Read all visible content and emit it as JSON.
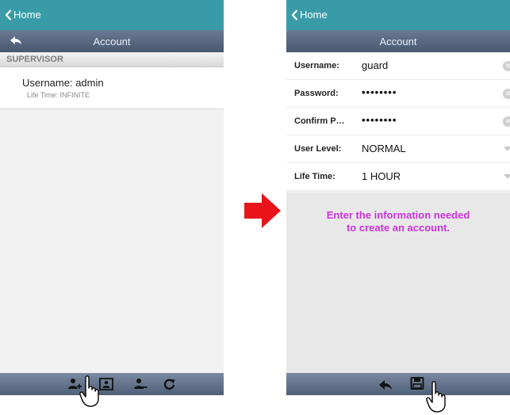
{
  "left": {
    "topbar": {
      "back_label": "Home"
    },
    "titlebar": {
      "title": "Account"
    },
    "section": {
      "label": "SUPERVISOR"
    },
    "list": [
      {
        "main": "Username: admin",
        "sub": "Life Time: INFINITE"
      }
    ],
    "bottom_icons": [
      "add-user-icon",
      "user-profile-icon",
      "delete-user-icon",
      "refresh-icon"
    ]
  },
  "right": {
    "topbar": {
      "back_label": "Home"
    },
    "titlebar": {
      "title": "Account"
    },
    "form": [
      {
        "label": "Username:",
        "value": "guard",
        "control": "clear"
      },
      {
        "label": "Password:",
        "value": "••••••••",
        "control": "clear"
      },
      {
        "label": "Confirm P…",
        "value": "••••••••",
        "control": "clear"
      },
      {
        "label": "User Level:",
        "value": "NORMAL",
        "control": "dropdown"
      },
      {
        "label": "Life Time:",
        "value": "1 HOUR",
        "control": "dropdown"
      }
    ],
    "instructions": [
      "Enter the information needed",
      "to create an account."
    ],
    "bottom_icons": [
      "back-arrow-icon",
      "save-icon"
    ]
  },
  "colors": {
    "topbar": "#3a9ba8",
    "titlebar": "#55657d",
    "instructions": "#cc33dd",
    "arrow": "#e8141a"
  }
}
